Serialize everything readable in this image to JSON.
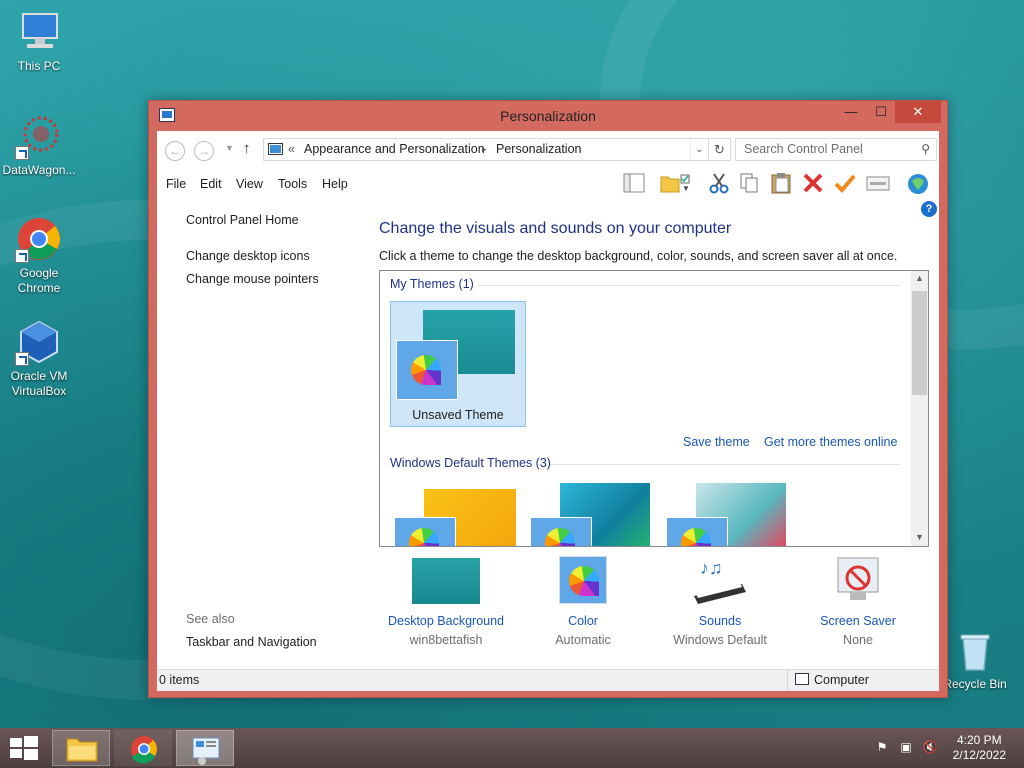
{
  "desktop": {
    "icons": [
      {
        "label": "This PC"
      },
      {
        "label": "DataWagon..."
      },
      {
        "label": "Google Chrome"
      },
      {
        "label": "Oracle VM VirtualBox"
      },
      {
        "label": "Recycle Bin"
      }
    ]
  },
  "window": {
    "title": "Personalization",
    "controls": {
      "minimize": "—",
      "maximize": "☐",
      "close": "✕"
    },
    "address": {
      "overflow": "«",
      "crumbs": [
        "Appearance and Personalization",
        "Personalization"
      ],
      "separator": "▸"
    },
    "search": {
      "placeholder": "Search Control Panel"
    },
    "menu": [
      "File",
      "Edit",
      "View",
      "Tools",
      "Help"
    ],
    "left_pane": {
      "home": "Control Panel Home",
      "links": [
        "Change desktop icons",
        "Change mouse pointers"
      ],
      "see_also": "See also",
      "see_also_links": [
        "Taskbar and Navigation"
      ]
    },
    "main": {
      "heading": "Change the visuals and sounds on your computer",
      "subtitle": "Click a theme to change the desktop background, color, sounds, and screen saver all at once.",
      "my_themes_title": "My Themes (1)",
      "unsaved_theme": "Unsaved Theme",
      "save_theme": "Save theme",
      "get_more": "Get more themes online",
      "default_themes_title": "Windows Default Themes (3)"
    },
    "bottom": [
      {
        "label": "Desktop Background",
        "value": "win8bettafish"
      },
      {
        "label": "Color",
        "value": "Automatic"
      },
      {
        "label": "Sounds",
        "value": "Windows Default"
      },
      {
        "label": "Screen Saver",
        "value": "None"
      }
    ],
    "status": {
      "items": "0 items",
      "location": "Computer"
    }
  },
  "taskbar": {
    "time": "4:20 PM",
    "date": "2/12/2022"
  },
  "colors": {
    "accent": "#d46a5f",
    "link": "#1a57b8",
    "heading": "#1e3287",
    "selected_tile": "#cfe6f8"
  },
  "icon_names": [
    "this-pc-icon",
    "datawagon-icon",
    "chrome-icon",
    "virtualbox-icon",
    "recycle-bin-icon",
    "folder-icon",
    "control-panel-icon",
    "help-icon"
  ]
}
